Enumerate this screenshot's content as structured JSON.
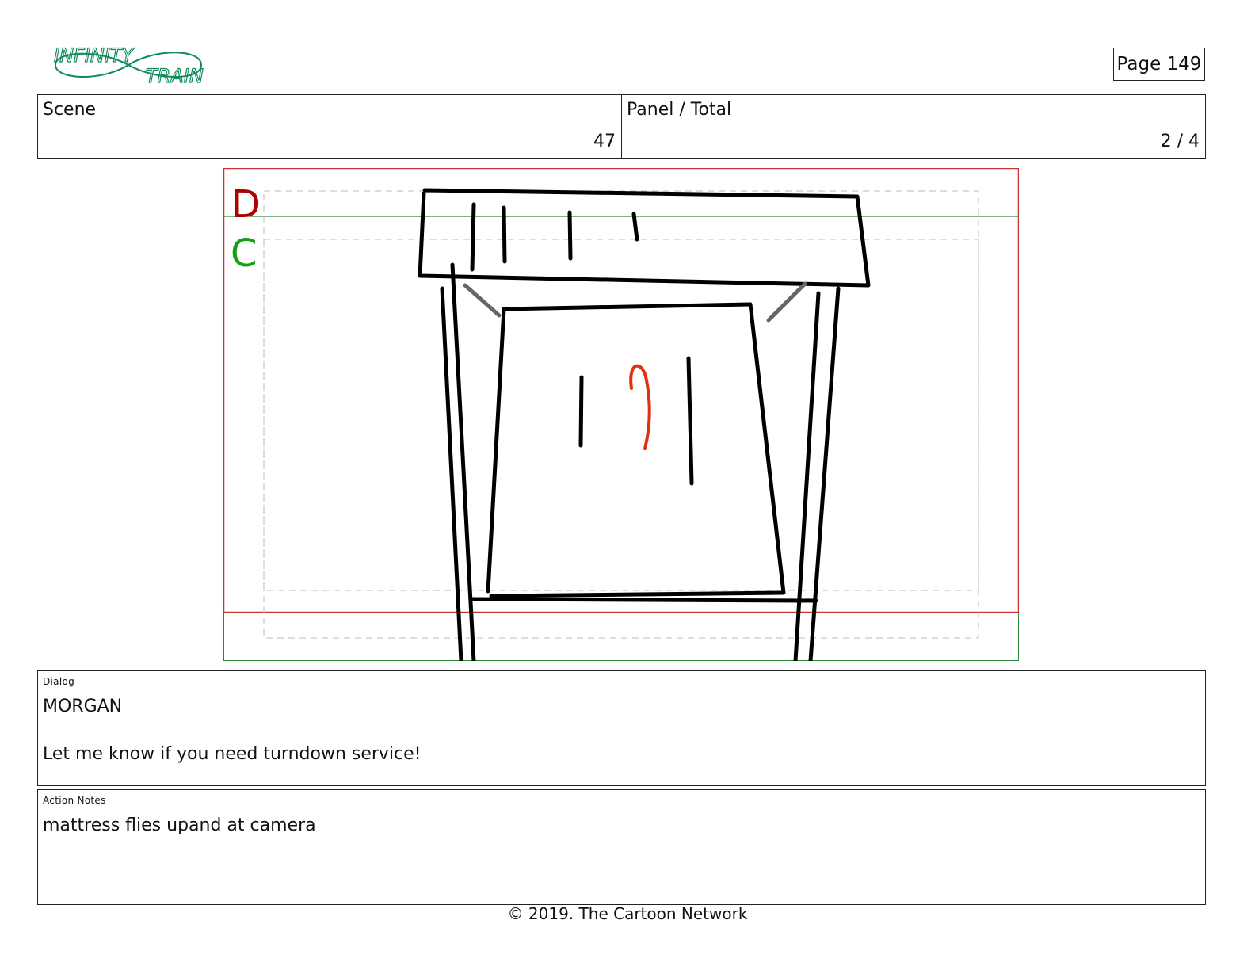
{
  "logo": {
    "line1": "INFINITY",
    "line2": "TRAIN",
    "color": "#0f8a5a"
  },
  "page": {
    "label": "Page 149"
  },
  "header": {
    "scene_label": "Scene",
    "scene_value": "47",
    "panel_label": "Panel / Total",
    "panel_value": "2 / 4"
  },
  "frame": {
    "marker_d": "D",
    "marker_c": "C",
    "marker_d_color": "#b00000",
    "marker_c_color": "#10a010",
    "safe_frame_color": "#cc3333",
    "guide_color": "#2a8a3a",
    "sketch_accent_color": "#e03010"
  },
  "dialog": {
    "label": "Dialog",
    "text": "MORGAN\n\nLet me know if you need turndown service!"
  },
  "action_notes": {
    "label": "Action Notes",
    "text": "mattress flies upand at camera"
  },
  "footer": {
    "copyright": "© 2019. The Cartoon Network"
  }
}
